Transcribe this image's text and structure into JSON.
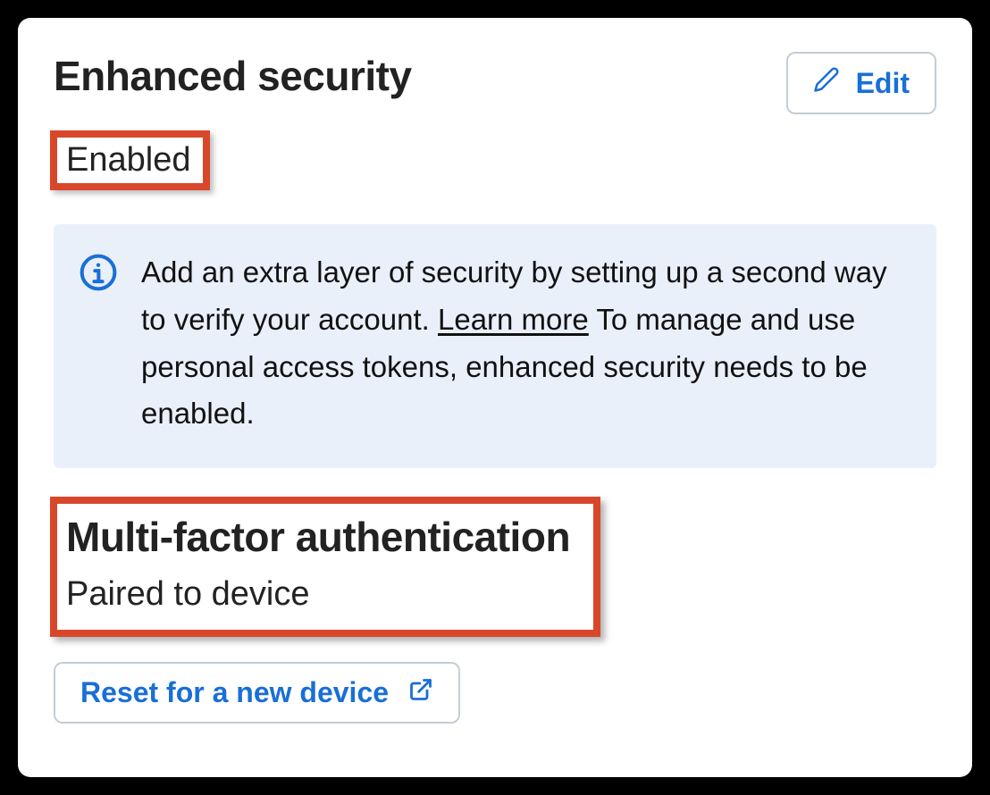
{
  "section": {
    "title": "Enhanced security",
    "edit_label": "Edit",
    "status": "Enabled",
    "info": {
      "text_a": "Add an extra layer of security by setting up a second way to verify your account. ",
      "learn_more": "Learn more",
      "text_b": " To manage and use personal access tokens, enhanced security needs to be enabled."
    },
    "mfa": {
      "title": "Multi-factor authentication",
      "status": "Paired to device",
      "reset_label": "Reset for a new device"
    }
  }
}
